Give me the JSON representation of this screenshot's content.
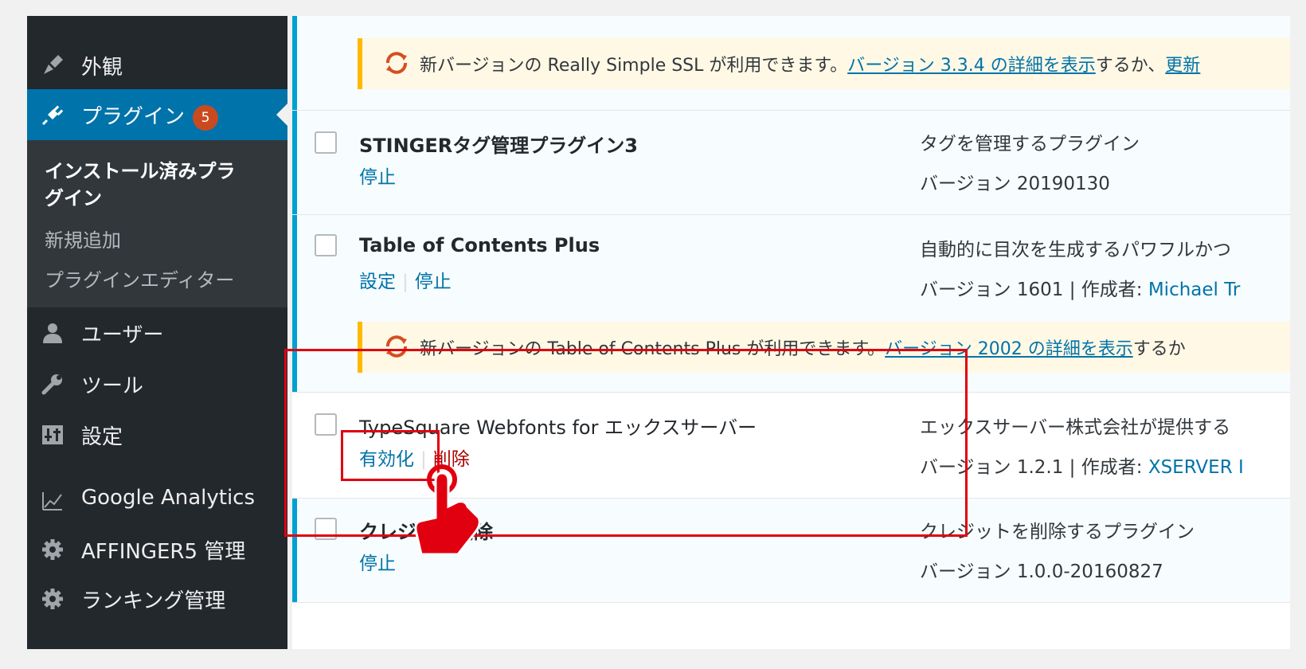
{
  "sidebar": {
    "items_top": [
      {
        "icon": "appearance-icon",
        "label": "外観"
      },
      {
        "icon": "plugins-icon",
        "label": "プラグイン",
        "badge": "5"
      }
    ],
    "submenu": [
      "インストール済みプラグイン",
      "新規追加",
      "プラグインエディター"
    ],
    "submenu_current_line1": "インストール済みプラ",
    "submenu_current_line2": "グイン",
    "items_bottom": [
      {
        "icon": "users-icon",
        "label": "ユーザー"
      },
      {
        "icon": "tools-icon",
        "label": "ツール"
      },
      {
        "icon": "settings-icon",
        "label": "設定"
      },
      {
        "icon": "analytics-icon",
        "label": "Google Analytics"
      },
      {
        "icon": "gear-icon",
        "label": "AFFINGER5 管理"
      },
      {
        "icon": "gear-icon",
        "label": "ランキング管理"
      }
    ]
  },
  "notices": [
    {
      "prefix": "新バージョンの Really Simple SSL が利用できます。",
      "link": "バージョン 3.3.4 の詳細を表示",
      "suffix": "するか、",
      "link2": "更新"
    },
    {
      "prefix": "新バージョンの Table of Contents Plus が利用できます。",
      "link": "バージョン 2002 の詳細を表示",
      "suffix": "するか"
    }
  ],
  "plugins": [
    {
      "name": "STINGERタグ管理プラグイン3",
      "actions": [
        "停止"
      ],
      "desc": "タグを管理するプラグイン",
      "version": "バージョン 20190130"
    },
    {
      "name": "Table of Contents Plus",
      "actions": [
        "設定",
        "停止"
      ],
      "desc": "自動的に目次を生成するパワフルかつ",
      "version": "バージョン 1601 | 作成者: ",
      "author": "Michael Tr"
    },
    {
      "name": "TypeSquare Webfonts for エックスサーバー",
      "actions": [
        "有効化",
        "削除"
      ],
      "desc": "エックスサーバー株式会社が提供する",
      "version": "バージョン 1.2.1 | 作成者: ",
      "author": "XSERVER I"
    },
    {
      "name": "クレジット削除",
      "actions": [
        "停止"
      ],
      "desc": "クレジットを削除するプラグイン",
      "version": "バージョン 1.0.0-20160827"
    }
  ]
}
